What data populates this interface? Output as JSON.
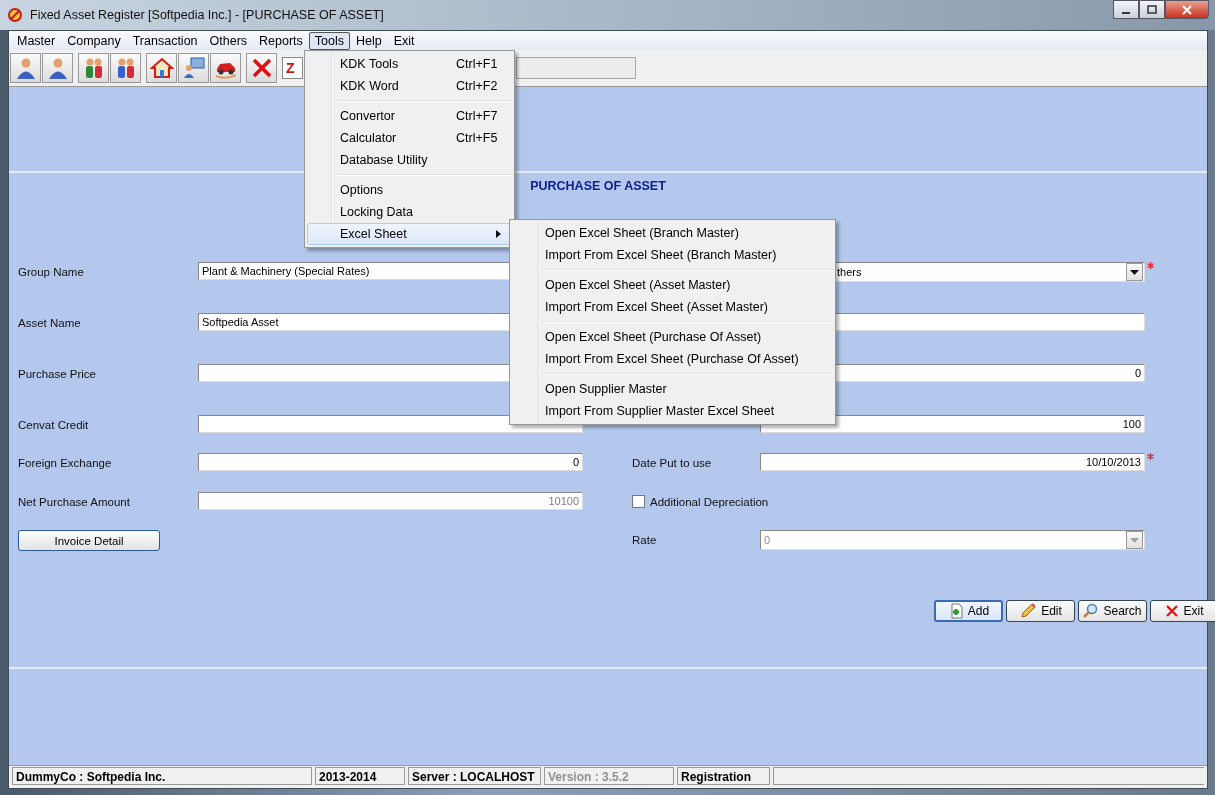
{
  "window": {
    "title": "Fixed Asset Register [Softpedia Inc.] - [PURCHASE OF ASSET]"
  },
  "menubar": [
    {
      "label": "Master",
      "selected": false
    },
    {
      "label": "Company",
      "selected": false
    },
    {
      "label": "Transaction",
      "selected": false
    },
    {
      "label": "Others",
      "selected": false
    },
    {
      "label": "Reports",
      "selected": false
    },
    {
      "label": "Tools",
      "selected": true
    },
    {
      "label": "Help",
      "selected": false
    },
    {
      "label": "Exit",
      "selected": false
    }
  ],
  "toolbar": {
    "code_field": {
      "value": "Z"
    }
  },
  "tools_menu": {
    "groups": [
      [
        {
          "label": "KDK Tools",
          "shortcut": "Ctrl+F1",
          "submenu": false,
          "selected": false
        },
        {
          "label": "KDK Word",
          "shortcut": "Ctrl+F2",
          "submenu": false,
          "selected": false
        }
      ],
      [
        {
          "label": "Convertor",
          "shortcut": "Ctrl+F7",
          "submenu": false,
          "selected": false
        },
        {
          "label": "Calculator",
          "shortcut": "Ctrl+F5",
          "submenu": false,
          "selected": false
        },
        {
          "label": "Database Utility",
          "submenu": false,
          "selected": false
        }
      ],
      [
        {
          "label": "Options",
          "submenu": false,
          "selected": false
        },
        {
          "label": "Locking Data",
          "submenu": false,
          "selected": false
        },
        {
          "label": "Excel Sheet",
          "submenu": true,
          "selected": true
        }
      ]
    ]
  },
  "excel_submenu": {
    "groups": [
      [
        {
          "label": "Open Excel Sheet (Branch Master)"
        },
        {
          "label": "Import From Excel Sheet (Branch Master)"
        }
      ],
      [
        {
          "label": "Open Excel Sheet (Asset Master)"
        },
        {
          "label": "Import From Excel Sheet  (Asset Master)"
        }
      ],
      [
        {
          "label": "Open Excel Sheet (Purchase Of Asset)"
        },
        {
          "label": "Import From Excel Sheet  (Purchase Of Asset)"
        }
      ],
      [
        {
          "label": "Open Supplier Master"
        },
        {
          "label": "Import From Supplier Master Excel Sheet"
        }
      ]
    ]
  },
  "form": {
    "title": "PURCHASE OF ASSET",
    "left": [
      {
        "kind": "text",
        "label": "Group Name",
        "value": "Plant & Machinery (Special Rates)"
      },
      {
        "kind": "text",
        "label": "Asset Name",
        "value": "Softpedia Asset"
      },
      {
        "kind": "number",
        "label": "Purchase Price"
      },
      {
        "kind": "number",
        "label": "Cenvat Credit"
      },
      {
        "kind": "number",
        "label": "Foreign Exchange",
        "value": "0"
      },
      {
        "kind": "readonly",
        "label": "Net Purchase Amount",
        "value": "10100"
      },
      {
        "kind": "button",
        "label": "Invoice Detail"
      }
    ],
    "right": [
      {
        "kind": "combo",
        "value": "thers",
        "required": true,
        "disabled": false
      },
      {
        "kind": "text",
        "required": false
      },
      {
        "kind": "number",
        "value": "0",
        "required": false
      },
      {
        "kind": "number",
        "value": "100",
        "required": false
      },
      {
        "kind": "number",
        "label": "Date Put to use",
        "value": "10/10/2013",
        "required": true
      },
      {
        "kind": "checkbox",
        "label": "Additional Depreciation",
        "checked": false
      },
      {
        "kind": "combo",
        "label": "Rate",
        "value": "0",
        "required": false,
        "disabled": true
      }
    ],
    "buttons": [
      {
        "label": "Add",
        "kind": "add",
        "selected": true
      },
      {
        "label": "Edit",
        "kind": "edit",
        "selected": false
      },
      {
        "label": "Search",
        "kind": "search",
        "selected": false
      },
      {
        "label": "Exit",
        "kind": "exit",
        "selected": false
      }
    ]
  },
  "status_bar": [
    {
      "text": "DummyCo : Softpedia Inc.",
      "disabled": false
    },
    {
      "text": "2013-2014",
      "disabled": false
    },
    {
      "text": "Server : LOCALHOST",
      "disabled": false
    },
    {
      "text": "Version : 3.5.2",
      "disabled": true
    },
    {
      "text": "Registration",
      "disabled": false
    }
  ]
}
